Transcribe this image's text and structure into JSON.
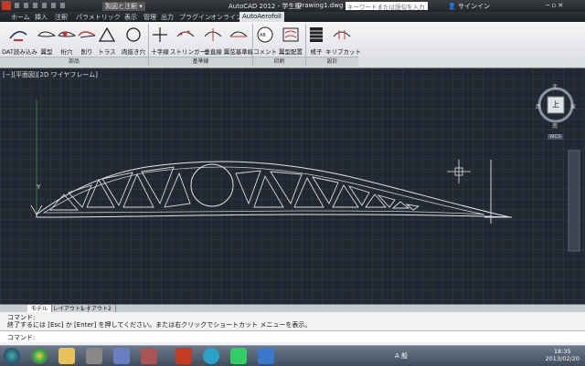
{
  "titlebar": {
    "app_title": "AutoCAD 2012 - 学生版",
    "file_name": "Drawing1.dwg",
    "workspace": "製図と注釈",
    "search_placeholder": "キーワードまたは語句を入力",
    "signin": "サインイン"
  },
  "menu": {
    "items": [
      "ホーム",
      "挿入",
      "注釈",
      "パラメトリック",
      "表示",
      "管理",
      "出力",
      "プラグイン",
      "オンライン",
      "AutoAerofoil"
    ],
    "active_index": 9
  },
  "ribbon": {
    "buttons": [
      {
        "label": "DAT読み込み",
        "icon": "import-icon"
      },
      {
        "label": "翼型",
        "icon": "airfoil-icon"
      },
      {
        "label": "桁穴",
        "icon": "spar-hole-icon"
      },
      {
        "label": "削り",
        "icon": "cut-icon"
      },
      {
        "label": "トラス",
        "icon": "truss-icon"
      },
      {
        "label": "肉抜き穴",
        "icon": "lightening-hole-icon"
      },
      {
        "label": "十字線",
        "icon": "crosshair-icon"
      },
      {
        "label": "ストリンガー",
        "icon": "stringer-icon"
      },
      {
        "label": "垂直線",
        "icon": "vertical-line-icon"
      },
      {
        "label": "翼弦基準線",
        "icon": "chord-line-icon"
      },
      {
        "label": "コメント",
        "icon": "comment-icon"
      },
      {
        "label": "翼型配置",
        "icon": "airfoil-layout-icon"
      },
      {
        "label": "桟子",
        "icon": "rib-icon"
      },
      {
        "label": "キリブカット",
        "icon": "rib-cut-icon"
      }
    ],
    "groups": [
      "部品",
      "基準線",
      "印刷",
      "設計"
    ]
  },
  "viewport": {
    "label": "[−][平面図][2D ワイヤフレーム]",
    "y_axis": "Y",
    "viewcube": {
      "top": "上",
      "north": "北",
      "south": "南",
      "east": "東",
      "west": "西",
      "wcs": "WCS"
    }
  },
  "tabs": [
    "モデル",
    "レイアウト1",
    "レイアウト2"
  ],
  "command": {
    "line1": "コマンド:",
    "line2": "終了するには [Esc] か [Enter] を押してください。または右クリックでショートカット メニューを表示。",
    "prompt": "コマンド:"
  },
  "taskbar": {
    "time": "18:35",
    "date": "2013/02/20",
    "ime": "A 般"
  },
  "colors": {
    "canvas": "#212832",
    "ribbon": "#e8eaed",
    "curve": "#e6e6e6",
    "accent": "#c23b22"
  }
}
